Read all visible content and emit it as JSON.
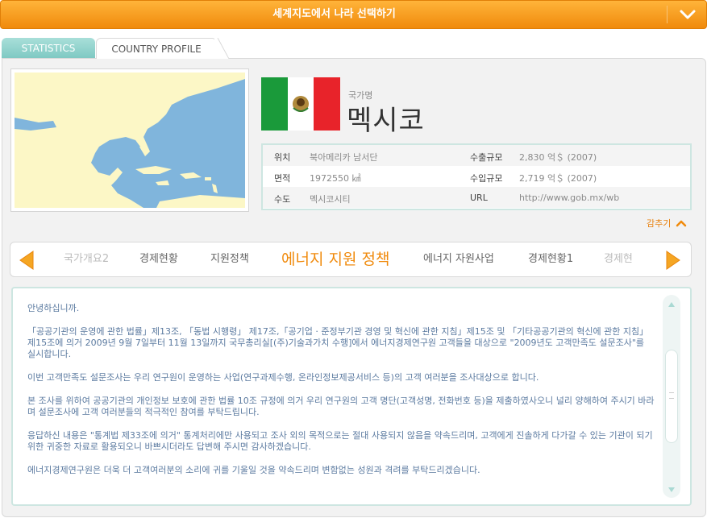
{
  "topbar": {
    "title": "세계지도에서 나라 선택하기",
    "toggle_icon": "chevron-down-icon"
  },
  "tabs": [
    {
      "label": "STATISTICS",
      "active": false
    },
    {
      "label": "COUNTRY PROFILE",
      "active": true
    }
  ],
  "country": {
    "name_label": "국가명",
    "name": "멕시코",
    "flag_colors": {
      "green": "#1a9a3a",
      "white": "#ffffff",
      "red": "#e8232a"
    }
  },
  "info": {
    "rows": [
      {
        "k1": "위치",
        "v1": "북아메리카 남서단",
        "k2": "수출규모",
        "v2": "2,830 억＄ (2007)"
      },
      {
        "k1": "면적",
        "v1": "1972550 ㎢",
        "k2": "수입규모",
        "v2": "2,719 억＄ (2007)"
      },
      {
        "k1": "수도",
        "v1": "멕시코시티",
        "k2": "URL",
        "v2": "http://www.gob.mx/wb"
      }
    ]
  },
  "collapse_label": "감추기",
  "menu": {
    "items": [
      "국가개요2",
      "경제현황",
      "지원정책",
      "에너지 지원 정책",
      "에너지 자원사업",
      "경제현황1",
      "경제현"
    ],
    "active_index": 3
  },
  "notice": {
    "paragraphs": [
      "안녕하십니까.",
      "「공공기관의 운영에 관한 법률」제13조, 「동법 시행령」 제17조,「공기업 · 준정부기관 경영 및 혁신에 관한 지침」제15조 및 「기타공공기관의 혁신에 관한 지침」제15조에 의거 2009년 9월 7일부터 11월 13일까지 국무총리실[(주)기술과가치 수행]에서 에너지경제연구원 고객들을 대상으로 \"2009년도 고객만족도 설문조사\"를 실시합니다.",
      "이번 고객만족도 설문조사는 우리 연구원이 운영하는 사업(연구과제수행, 온라인정보제공서비스 등)의 고객 여러분을 조사대상으로 합니다.",
      "본 조사를 위하여 공공기관의 개인정보 보호에 관한 법률 10조 규정에 의거 우리 연구원의 고객 명단(고객성명, 전화번호 등)을 제출하였사오니 널리 양해하여 주시기 바라며 설문조사에 고객 여러분들의 적극적인 참여를 부탁드립니다.",
      "응답하신 내용은 \"통계법 제33조에 의거\" 통계처리에만 사용되고 조사 외의 목적으로는 절대 사용되지 않음을 약속드리며, 고객에게 진솔하게 다가갈 수 있는 기관이 되기 위한 귀중한 자료로 활용되오니 바쁘시더라도 답변해 주시면 감사하겠습니다.",
      "에너지경제연구원은 더욱 더 고객여러분의 소리에 귀를 기울일 것을 약속드리며 변함없는 성원과 격려를 부탁드리겠습니다."
    ]
  }
}
